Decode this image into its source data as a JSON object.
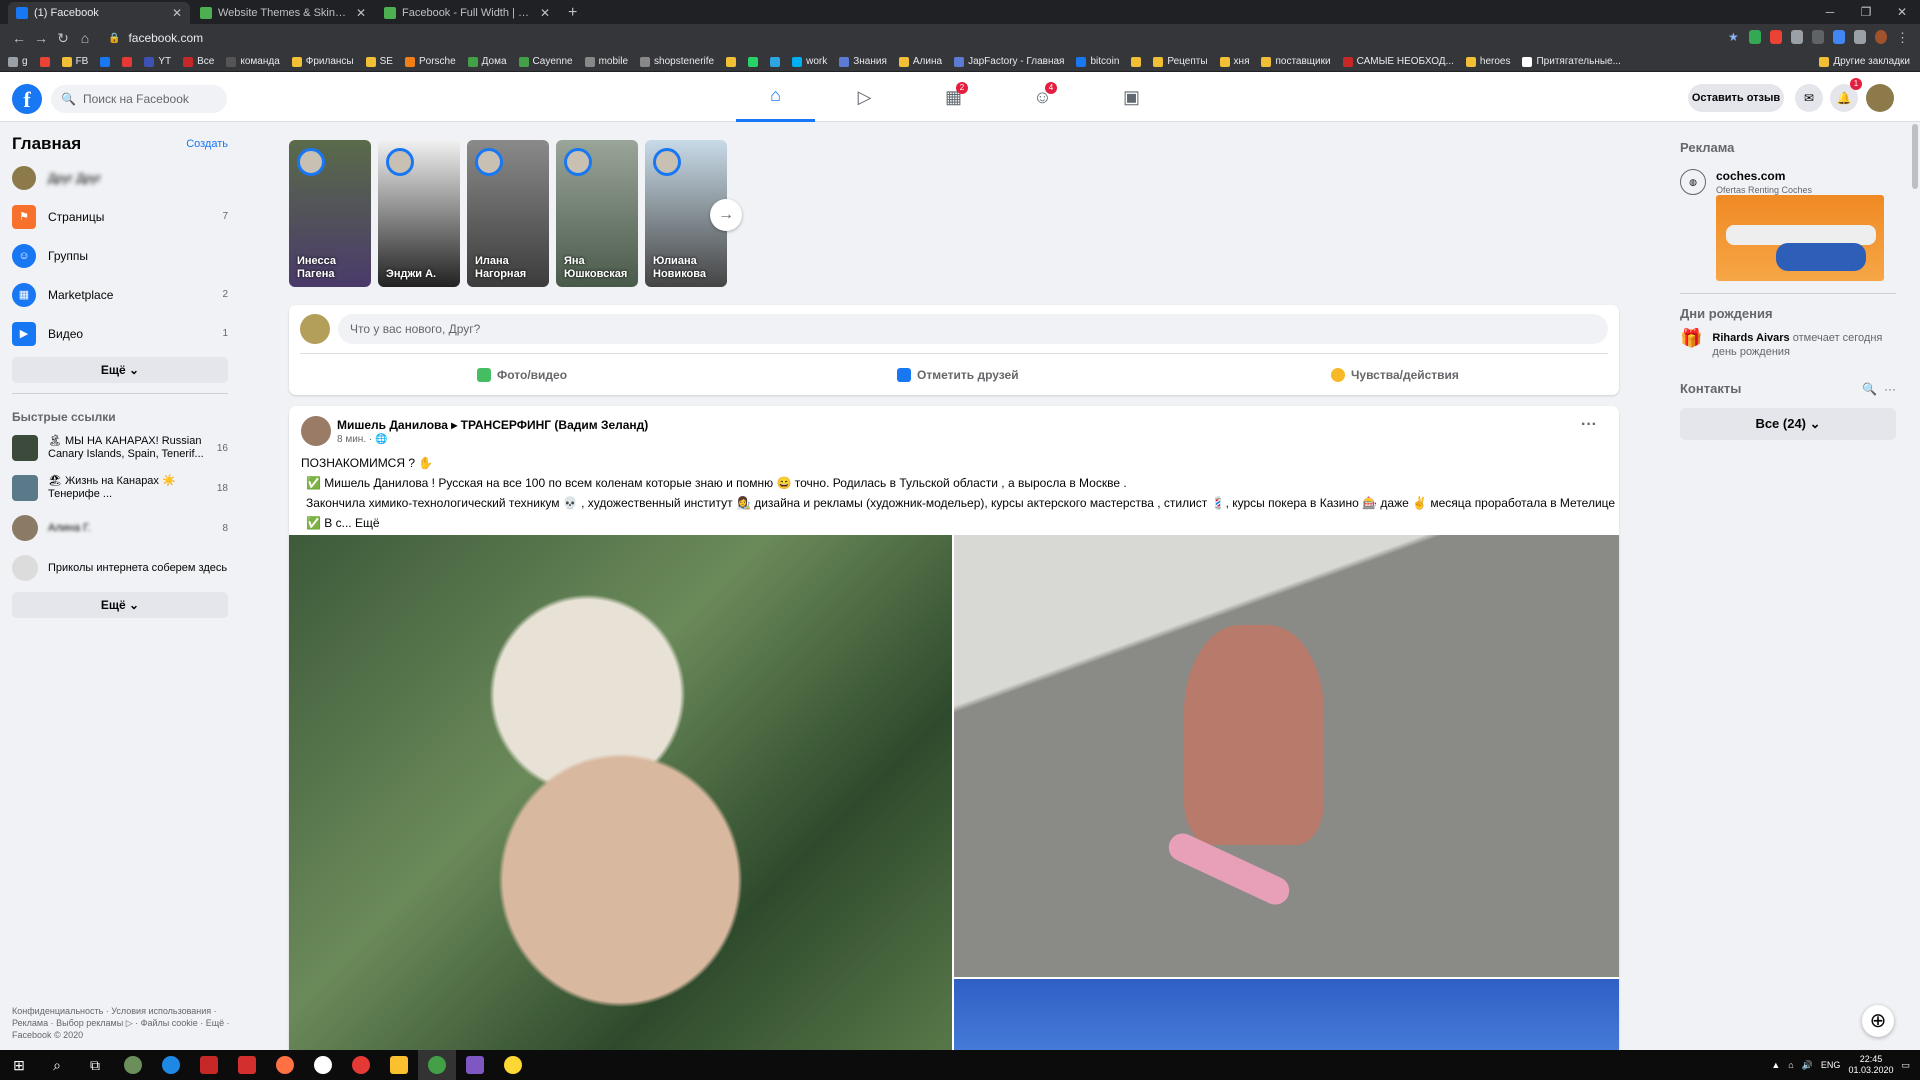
{
  "browser": {
    "tabs": [
      {
        "title": "(1) Facebook",
        "active": true,
        "color": "#1877f2"
      },
      {
        "title": "Website Themes & Skins by Styli…",
        "active": false,
        "color": "#4caf50"
      },
      {
        "title": "Facebook - Full Width | Userstyle…",
        "active": false,
        "color": "#4caf50"
      }
    ],
    "url": "facebook.com",
    "bookmarks": [
      "g",
      "",
      "FB",
      "",
      "",
      "YT",
      "Все",
      "команда",
      "Фрилансы",
      "SE",
      "Porsche",
      "Дома",
      "Cayenne",
      "mobile",
      "shopstenerife",
      "",
      "",
      "",
      "work",
      "Знания",
      "Алина",
      "JapFactory - Главная",
      "bitcoin",
      "",
      "Рецепты",
      "хня",
      "поставщики",
      "САМЫЕ НЕОБХОД...",
      "heroes",
      "Притягательные..."
    ],
    "other_bookmarks": "Другие закладки"
  },
  "header": {
    "logo": "f",
    "search_placeholder": "Поиск на Facebook",
    "nav": [
      {
        "icon": "home-icon",
        "glyph": "⌂",
        "badge": ""
      },
      {
        "icon": "watch-icon",
        "glyph": "▷",
        "badge": ""
      },
      {
        "icon": "marketplace-icon",
        "glyph": "▦",
        "badge": "2"
      },
      {
        "icon": "groups-icon",
        "glyph": "☺",
        "badge": "4"
      },
      {
        "icon": "gaming-icon",
        "glyph": "▣",
        "badge": ""
      }
    ],
    "feedback": "Оставить отзыв",
    "notif_badge": "1"
  },
  "left": {
    "title": "Главная",
    "create": "Создать",
    "profile_name": "Друг Друг",
    "items": [
      {
        "label": "Страницы",
        "count": "7",
        "color": "#f7702c",
        "icon": "pages-icon"
      },
      {
        "label": "Группы",
        "count": "",
        "color": "#1877f2",
        "icon": "groups-icon"
      },
      {
        "label": "Marketplace",
        "count": "2",
        "color": "#1877f2",
        "icon": "marketplace-icon"
      },
      {
        "label": "Видео",
        "count": "1",
        "color": "#1877f2",
        "icon": "video-icon"
      }
    ],
    "more": "Ещё",
    "shortcuts_title": "Быстрые ссылки",
    "shortcuts": [
      {
        "label": "🏝 МЫ НА КАНАРАХ! Russian Canary Islands, Spain, Tenerif...",
        "count": "16"
      },
      {
        "label": "🏖 Жизнь на Канарах ☀️ Тенерифе ...",
        "count": "18"
      },
      {
        "label": "Алина Г.",
        "count": "8"
      },
      {
        "label": "Приколы интернета соберем здесь",
        "count": ""
      }
    ],
    "more2": "Ещё",
    "footer": "Конфиденциальность · Условия использования · Реклама · Выбор рекламы ▷ · Файлы cookie · Ещё · Facebook © 2020"
  },
  "stories": [
    {
      "name": "Инесса Пагена",
      "bg": "linear-gradient(#5a6b4a,#4a3a6a)"
    },
    {
      "name": "Энджи А.",
      "bg": "linear-gradient(#f1f1f1,#222)"
    },
    {
      "name": "Илана Нагорная",
      "bg": "linear-gradient(#8a8a8a,#3c3c3c)"
    },
    {
      "name": "Яна Юшковская",
      "bg": "linear-gradient(#9aa59a,#4a5a4a)"
    },
    {
      "name": "Юлиана Новикова",
      "bg": "linear-gradient(#c8dbe8,#444)"
    }
  ],
  "composer": {
    "placeholder": "Что у вас нового, Друг?",
    "actions": [
      {
        "label": "Фото/видео",
        "color": "#45bd62"
      },
      {
        "label": "Отметить друзей",
        "color": "#1877f2"
      },
      {
        "label": "Чувства/действия",
        "color": "#f7b928"
      }
    ]
  },
  "post": {
    "author": "Мишель Данилова ▸ ТРАНСЕРФИНГ (Вадим Зеланд)",
    "time": "8 мин. · 🌐",
    "lines": [
      "ПОЗНАКОМИМСЯ ? ✋",
      "✅ Мишель Данилова ! Русская на все 100 по всем коленам которые знаю и помню 😄 точно. Родилась в Тульской области , а выросла в Москве .",
      "Закончила химико-технологический техникум 💀 , художественный институт 👩‍🎨 дизайна и рекламы (художник-модельер), курсы актерского мастерства , стилист 💈, курсы покера в Казино 🎰 даже ✌️ месяца проработала в Метелице на Н. Арбате 🤣 .",
      "✅ В с... Ещё"
    ],
    "menu": "···"
  },
  "right": {
    "ads_title": "Реклама",
    "ad_name": "coches.com",
    "ad_sub": "Ofertas Renting Coches",
    "birthdays_title": "Дни рождения",
    "birthday_name": "Rihards Aivars",
    "birthday_text": "отмечает сегодня день рождения",
    "contacts_title": "Контакты",
    "contacts_all": "Все (24)"
  },
  "taskbar": {
    "lang": "ENG",
    "time": "22:45",
    "date": "01.03.2020"
  }
}
